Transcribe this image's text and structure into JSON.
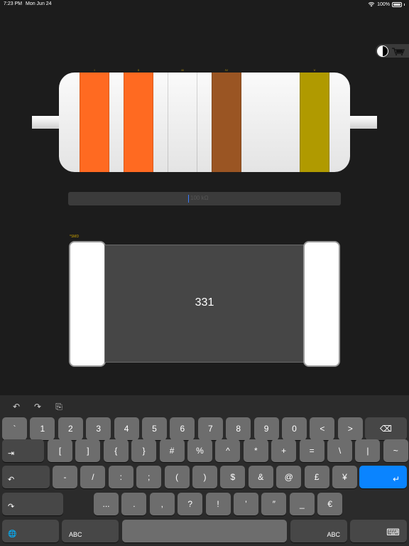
{
  "status_bar": {
    "time": "7:23 PM",
    "date": "Mon Jun 24",
    "battery": "100%"
  },
  "resistor": {
    "bands": [
      {
        "label": "I",
        "color": "#ff6a21"
      },
      {
        "label": "II",
        "color": "#ff6a21"
      },
      {
        "label": "III",
        "color": ""
      },
      {
        "label": "IV",
        "color": "#9a5523"
      },
      {
        "label": "V",
        "color": "#b09a00"
      }
    ]
  },
  "value_field": {
    "placeholder": "100 kΩ"
  },
  "smd": {
    "label": "*SMD",
    "code": "331"
  },
  "keyboard": {
    "toolbar": {
      "undo": "↶",
      "redo": "↷",
      "paste": "⎘"
    },
    "row1": [
      "`",
      "1",
      "2",
      "3",
      "4",
      "5",
      "6",
      "7",
      "8",
      "9",
      "0",
      "<",
      ">"
    ],
    "row2": [
      "[",
      "]",
      "{",
      "}",
      "#",
      "%",
      "^",
      "*",
      "+",
      "=",
      "\\",
      "|",
      "~"
    ],
    "row3": [
      "-",
      "/",
      ":",
      ";",
      "(",
      ")",
      "$",
      "&",
      "@",
      "£",
      "¥"
    ],
    "row4": [
      "...",
      ".",
      ",",
      "?",
      "!",
      "’",
      "″",
      "_",
      "€"
    ],
    "abc_left": "ABC",
    "abc_right": "ABC",
    "tab_glyph": "⇥",
    "undo_glyph": "↶",
    "redo_glyph": "↷",
    "return_glyph": "↵",
    "delete_glyph": "⌫",
    "globe_glyph": "🌐",
    "hide_glyph": "⌨"
  }
}
